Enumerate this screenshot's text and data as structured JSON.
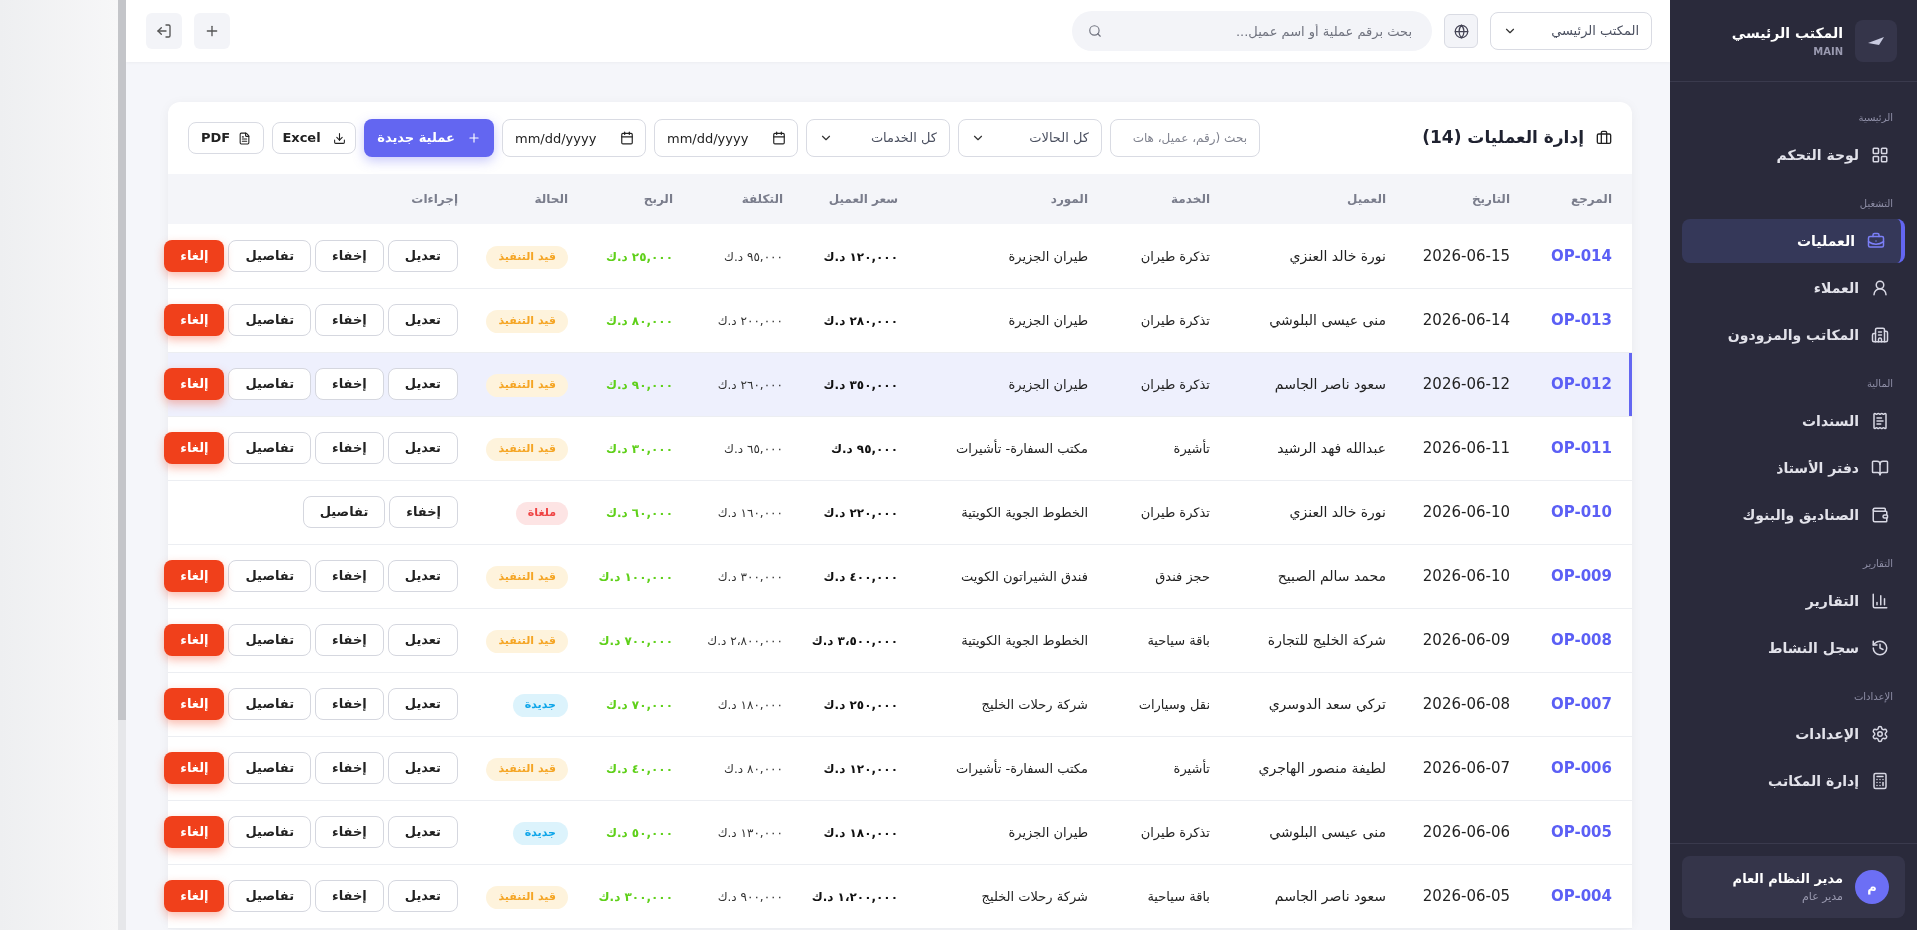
{
  "sidebar": {
    "brand": {
      "title": "المكتب الرئيسي",
      "subtitle": "MAIN"
    },
    "sections": [
      {
        "label": "الرئيسية",
        "items": [
          {
            "label": "لوحة التحكم",
            "selected": false
          }
        ]
      },
      {
        "label": "التشغيل",
        "items": [
          {
            "label": "العمليات",
            "selected": true
          },
          {
            "label": "العملاء",
            "selected": false
          },
          {
            "label": "المكاتب والمزودون",
            "selected": false
          }
        ]
      },
      {
        "label": "المالية",
        "items": [
          {
            "label": "السندات",
            "selected": false
          },
          {
            "label": "دفتر الأستاذ",
            "selected": false
          },
          {
            "label": "الصناديق والبنوك",
            "selected": false
          }
        ]
      },
      {
        "label": "التقارير",
        "items": [
          {
            "label": "التقارير",
            "selected": false
          },
          {
            "label": "سجل النشاط",
            "selected": false
          }
        ]
      },
      {
        "label": "الإعدادات",
        "items": [
          {
            "label": "الإعدادات",
            "selected": false
          },
          {
            "label": "إدارة المكاتب",
            "selected": false
          }
        ]
      }
    ],
    "user": {
      "initial": "م",
      "name": "مدير النظام العام",
      "role": "مدير عام"
    }
  },
  "topbar": {
    "office_select": "المكتب الرئيسي",
    "search": {
      "placeholder": "بحث برقم عملية أو اسم عميل..."
    }
  },
  "operations": {
    "title": "إدارة العمليات (14)",
    "filters": {
      "search": {
        "placeholder": "بحث (رقم، عميل، هات"
      },
      "status_select": "كل الحالات",
      "service_select": "كل الخدمات",
      "date_from": {
        "placeholder": "mm/dd/yyyy"
      },
      "date_to": {
        "placeholder": "mm/dd/yyyy"
      }
    },
    "buttons": [
      {
        "label": "عملية جديدة",
        "kind": "primary"
      },
      {
        "label": "Excel",
        "kind": "excel"
      },
      {
        "label": "PDF",
        "kind": "pdf"
      }
    ],
    "table": {
      "columns": [
        "المرجع",
        "التاريخ",
        "العميل",
        "الخدمة",
        "المورد",
        "سعر العميل",
        "التكلفة",
        "الربح",
        "الحالة",
        "إجراءات"
      ],
      "rows": [
        {
          "ref": "OP-014",
          "date": "2026-06-15",
          "client": "نورة خالد العنزي",
          "service": "تذكرة طيران",
          "supplier": "طيران الجزيرة",
          "price": "١٢٠,٠٠٠ د.ك",
          "cost": "٩٥,٠٠٠ د.ك",
          "profit": "٢٥,٠٠٠ د.ك",
          "status": {
            "label": "قيد التنفيذ",
            "kind": "progress"
          },
          "selected": false,
          "actions": [
            {
              "label": "تعديل",
              "kind": "outline"
            },
            {
              "label": "إخفاء",
              "kind": "outline"
            },
            {
              "label": "تفاصيل",
              "kind": "outline"
            },
            {
              "label": "إلغاء",
              "kind": "danger"
            }
          ]
        },
        {
          "ref": "OP-013",
          "date": "2026-06-14",
          "client": "منى عيسى البلوشي",
          "service": "تذكرة طيران",
          "supplier": "طيران الجزيرة",
          "price": "٢٨٠,٠٠٠ د.ك",
          "cost": "٢٠٠,٠٠٠ د.ك",
          "profit": "٨٠,٠٠٠ د.ك",
          "status": {
            "label": "قيد التنفيذ",
            "kind": "progress"
          },
          "selected": false,
          "actions": [
            {
              "label": "تعديل",
              "kind": "outline"
            },
            {
              "label": "إخفاء",
              "kind": "outline"
            },
            {
              "label": "تفاصيل",
              "kind": "outline"
            },
            {
              "label": "إلغاء",
              "kind": "danger"
            }
          ]
        },
        {
          "ref": "OP-012",
          "date": "2026-06-12",
          "client": "سعود ناصر الجاسم",
          "service": "تذكرة طيران",
          "supplier": "طيران الجزيرة",
          "price": "٣٥٠,٠٠٠ د.ك",
          "cost": "٢٦٠,٠٠٠ د.ك",
          "profit": "٩٠,٠٠٠ د.ك",
          "status": {
            "label": "قيد التنفيذ",
            "kind": "progress"
          },
          "selected": true,
          "actions": [
            {
              "label": "تعديل",
              "kind": "outline"
            },
            {
              "label": "إخفاء",
              "kind": "outline"
            },
            {
              "label": "تفاصيل",
              "kind": "outline"
            },
            {
              "label": "إلغاء",
              "kind": "danger"
            }
          ]
        },
        {
          "ref": "OP-011",
          "date": "2026-06-11",
          "client": "عبدالله فهد الرشيد",
          "service": "تأشيرة",
          "supplier": "مكتب السفارة- تأشيرات",
          "price": "٩٥,٠٠٠ د.ك",
          "cost": "٦٥,٠٠٠ د.ك",
          "profit": "٣٠,٠٠٠ د.ك",
          "status": {
            "label": "قيد التنفيذ",
            "kind": "progress"
          },
          "selected": false,
          "actions": [
            {
              "label": "تعديل",
              "kind": "outline"
            },
            {
              "label": "إخفاء",
              "kind": "outline"
            },
            {
              "label": "تفاصيل",
              "kind": "outline"
            },
            {
              "label": "إلغاء",
              "kind": "danger"
            }
          ]
        },
        {
          "ref": "OP-010",
          "date": "2026-06-10",
          "client": "نورة خالد العنزي",
          "service": "تذكرة طيران",
          "supplier": "الخطوط الجوية الكويتية",
          "price": "٢٢٠,٠٠٠ د.ك",
          "cost": "١٦٠,٠٠٠ د.ك",
          "profit": "٦٠,٠٠٠ د.ك",
          "status": {
            "label": "ملغاة",
            "kind": "cancelled"
          },
          "selected": false,
          "actions": [
            {
              "label": "إخفاء",
              "kind": "outline"
            },
            {
              "label": "تفاصيل",
              "kind": "outline"
            }
          ]
        },
        {
          "ref": "OP-009",
          "date": "2026-06-10",
          "client": "محمد سالم الصبيح",
          "service": "حجز فندق",
          "supplier": "فندق الشيراتون الكويت",
          "price": "٤٠٠,٠٠٠ د.ك",
          "cost": "٣٠٠,٠٠٠ د.ك",
          "profit": "١٠٠,٠٠٠ د.ك",
          "status": {
            "label": "قيد التنفيذ",
            "kind": "progress"
          },
          "selected": false,
          "actions": [
            {
              "label": "تعديل",
              "kind": "outline"
            },
            {
              "label": "إخفاء",
              "kind": "outline"
            },
            {
              "label": "تفاصيل",
              "kind": "outline"
            },
            {
              "label": "إلغاء",
              "kind": "danger"
            }
          ]
        },
        {
          "ref": "OP-008",
          "date": "2026-06-09",
          "client": "شركة الخليج للتجارة",
          "service": "باقة سياحية",
          "supplier": "الخطوط الجوية الكويتية",
          "price": "٣،٥٠٠,٠٠٠ د.ك",
          "cost": "٢،٨٠٠,٠٠٠ د.ك",
          "profit": "٧٠٠,٠٠٠ د.ك",
          "status": {
            "label": "قيد التنفيذ",
            "kind": "progress"
          },
          "selected": false,
          "actions": [
            {
              "label": "تعديل",
              "kind": "outline"
            },
            {
              "label": "إخفاء",
              "kind": "outline"
            },
            {
              "label": "تفاصيل",
              "kind": "outline"
            },
            {
              "label": "إلغاء",
              "kind": "danger"
            }
          ]
        },
        {
          "ref": "OP-007",
          "date": "2026-06-08",
          "client": "تركي سعد الدوسري",
          "service": "نقل وسيارات",
          "supplier": "شركة رحلات الخليج",
          "price": "٢٥٠,٠٠٠ د.ك",
          "cost": "١٨٠,٠٠٠ د.ك",
          "profit": "٧٠,٠٠٠ د.ك",
          "status": {
            "label": "جديدة",
            "kind": "new"
          },
          "selected": false,
          "actions": [
            {
              "label": "تعديل",
              "kind": "outline"
            },
            {
              "label": "إخفاء",
              "kind": "outline"
            },
            {
              "label": "تفاصيل",
              "kind": "outline"
            },
            {
              "label": "إلغاء",
              "kind": "danger"
            }
          ]
        },
        {
          "ref": "OP-006",
          "date": "2026-06-07",
          "client": "لطيفة منصور الهاجري",
          "service": "تأشيرة",
          "supplier": "مكتب السفارة- تأشيرات",
          "price": "١٢٠,٠٠٠ د.ك",
          "cost": "٨٠,٠٠٠ د.ك",
          "profit": "٤٠,٠٠٠ د.ك",
          "status": {
            "label": "قيد التنفيذ",
            "kind": "progress"
          },
          "selected": false,
          "actions": [
            {
              "label": "تعديل",
              "kind": "outline"
            },
            {
              "label": "إخفاء",
              "kind": "outline"
            },
            {
              "label": "تفاصيل",
              "kind": "outline"
            },
            {
              "label": "إلغاء",
              "kind": "danger"
            }
          ]
        },
        {
          "ref": "OP-005",
          "date": "2026-06-06",
          "client": "منى عيسى البلوشي",
          "service": "تذكرة طيران",
          "supplier": "طيران الجزيرة",
          "price": "١٨٠,٠٠٠ د.ك",
          "cost": "١٣٠,٠٠٠ د.ك",
          "profit": "٥٠,٠٠٠ د.ك",
          "status": {
            "label": "جديدة",
            "kind": "new"
          },
          "selected": false,
          "actions": [
            {
              "label": "تعديل",
              "kind": "outline"
            },
            {
              "label": "إخفاء",
              "kind": "outline"
            },
            {
              "label": "تفاصيل",
              "kind": "outline"
            },
            {
              "label": "إلغاء",
              "kind": "danger"
            }
          ]
        },
        {
          "ref": "OP-004",
          "date": "2026-06-05",
          "client": "سعود ناصر الجاسم",
          "service": "باقة سياحية",
          "supplier": "شركة رحلات الخليج",
          "price": "١،٢٠٠,٠٠٠ د.ك",
          "cost": "٩٠٠,٠٠٠ د.ك",
          "profit": "٣٠٠,٠٠٠ د.ك",
          "status": {
            "label": "قيد التنفيذ",
            "kind": "progress"
          },
          "selected": false,
          "actions": [
            {
              "label": "تعديل",
              "kind": "outline"
            },
            {
              "label": "إخفاء",
              "kind": "outline"
            },
            {
              "label": "تفاصيل",
              "kind": "outline"
            },
            {
              "label": "إلغاء",
              "kind": "danger"
            }
          ]
        }
      ]
    }
  }
}
